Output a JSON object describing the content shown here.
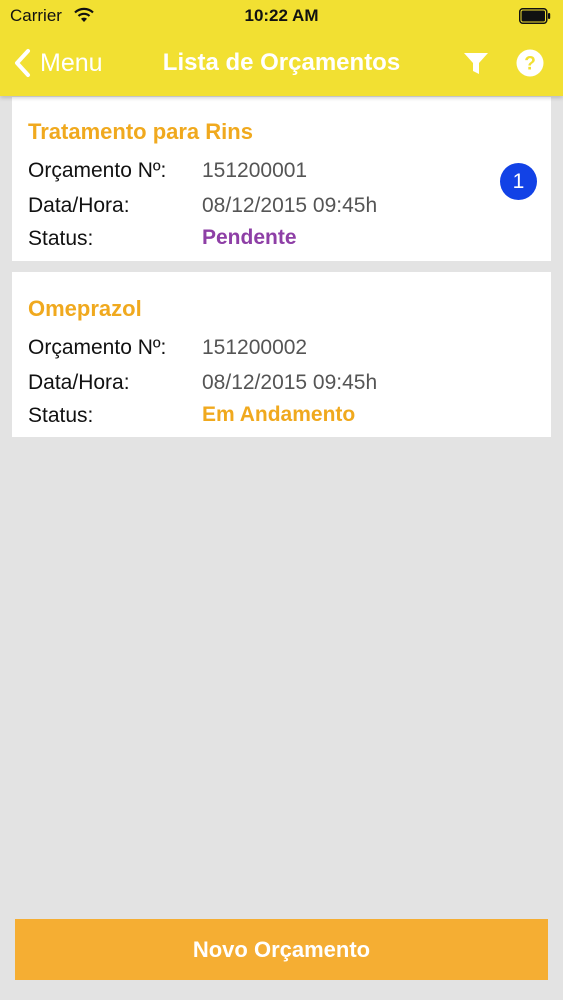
{
  "status_bar": {
    "carrier": "Carrier",
    "time": "10:22 AM"
  },
  "nav": {
    "back_label": "Menu",
    "title": "Lista de Orçamentos",
    "icons": [
      "chevron-left-icon",
      "filter-icon",
      "help-icon"
    ]
  },
  "budgets": [
    {
      "title": "Tratamento para Rins",
      "number_label": "Orçamento Nº:",
      "number": "151200001",
      "date_label": "Data/Hora:",
      "date": "08/12/2015 09:45h",
      "status_label": "Status:",
      "status": "Pendente",
      "badge": "1"
    },
    {
      "title": "Omeprazol",
      "number_label": "Orçamento Nº:",
      "number": "151200002",
      "date_label": "Data/Hora:",
      "date": "08/12/2015 09:45h",
      "status_label": "Status:",
      "status": "Em Andamento"
    }
  ],
  "footer": {
    "new_button_label": "Novo Orçamento"
  },
  "colors": {
    "header": "#f2e032",
    "accent": "#f0a91e",
    "pending": "#8e3fa6",
    "badge": "#1242e6",
    "button": "#f5ae33",
    "background": "#e3e3e3"
  }
}
